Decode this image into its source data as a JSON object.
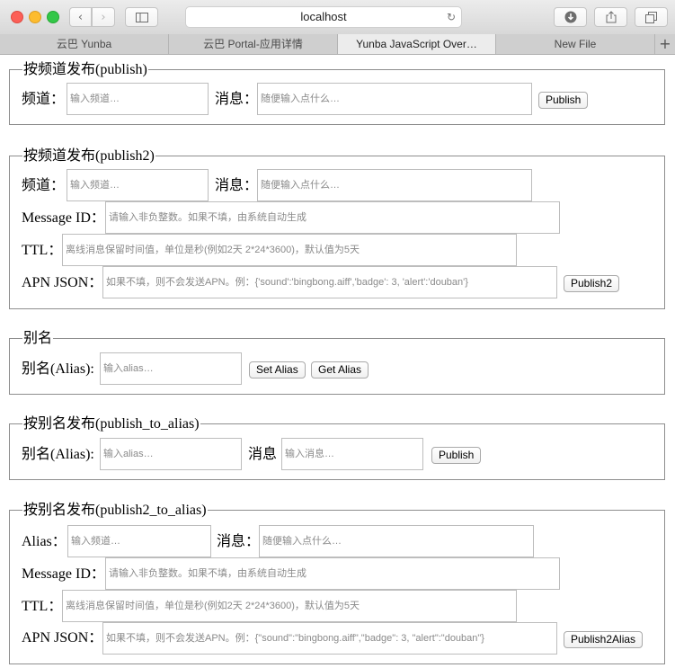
{
  "browser": {
    "address": "localhost",
    "tabs": [
      "云巴 Yunba",
      "云巴 Portal-应用详情",
      "Yunba JavaScript Over…",
      "New File"
    ],
    "new_tab": "+"
  },
  "section_publish": {
    "legend": "按频道发布(publish)",
    "channel_label": "频道：",
    "channel_placeholder": "输入频道…",
    "message_label": "消息：",
    "message_placeholder": "随便输入点什么…",
    "button": "Publish"
  },
  "section_publish2": {
    "legend": "按频道发布(publish2)",
    "channel_label": "频道：",
    "channel_placeholder": "输入频道…",
    "message_label": "消息：",
    "message_placeholder": "随便输入点什么…",
    "message_id_label": "Message ID：",
    "message_id_placeholder": "请输入非负整数。如果不填，由系统自动生成",
    "ttl_label": "TTL：",
    "ttl_placeholder": "离线消息保留时间值，单位是秒(例如2天 2*24*3600)，默认值为5天",
    "apn_label": "APN JSON：",
    "apn_placeholder": "如果不填，则不会发送APN。例：{'sound':'bingbong.aiff','badge': 3, 'alert':'douban'}",
    "button": "Publish2"
  },
  "section_alias": {
    "legend": "别名",
    "alias_label": "别名(Alias):",
    "alias_placeholder": "输入alias…",
    "set_button": "Set Alias",
    "get_button": "Get Alias"
  },
  "section_publish_to_alias": {
    "legend": "按别名发布(publish_to_alias)",
    "alias_label": "别名(Alias):",
    "alias_placeholder": "输入alias…",
    "message_label": "消息",
    "message_placeholder": "输入消息…",
    "button": "Publish"
  },
  "section_publish2_to_alias": {
    "legend": "按别名发布(publish2_to_alias)",
    "alias_label": "Alias：",
    "alias_placeholder": "输入频道…",
    "message_label": "消息：",
    "message_placeholder": "随便输入点什么…",
    "message_id_label": "Message ID：",
    "message_id_placeholder": "请输入非负整数。如果不填，由系统自动生成",
    "ttl_label": "TTL：",
    "ttl_placeholder": "离线消息保留时间值，单位是秒(例如2天 2*24*3600)，默认值为5天",
    "apn_label": "APN JSON：",
    "apn_placeholder": "如果不填，则不会发送APN。例：{\"sound\":\"bingbong.aiff\",\"badge\": 3, \"alert\":\"douban\"}",
    "button": "Publish2Alias"
  }
}
